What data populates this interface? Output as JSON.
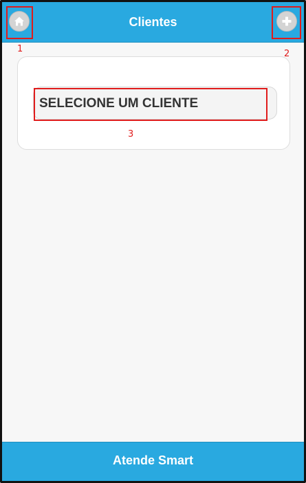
{
  "header": {
    "title": "Clientes",
    "home_icon": "home-icon",
    "add_icon": "plus-icon"
  },
  "main": {
    "select_client_label": "SELECIONE UM CLIENTE"
  },
  "footer": {
    "title": "Atende Smart"
  },
  "annotations": {
    "home_marker": "1",
    "add_marker": "2",
    "select_marker": "3"
  },
  "colors": {
    "bar": "#29a9e0",
    "marker": "#e01b1b"
  }
}
